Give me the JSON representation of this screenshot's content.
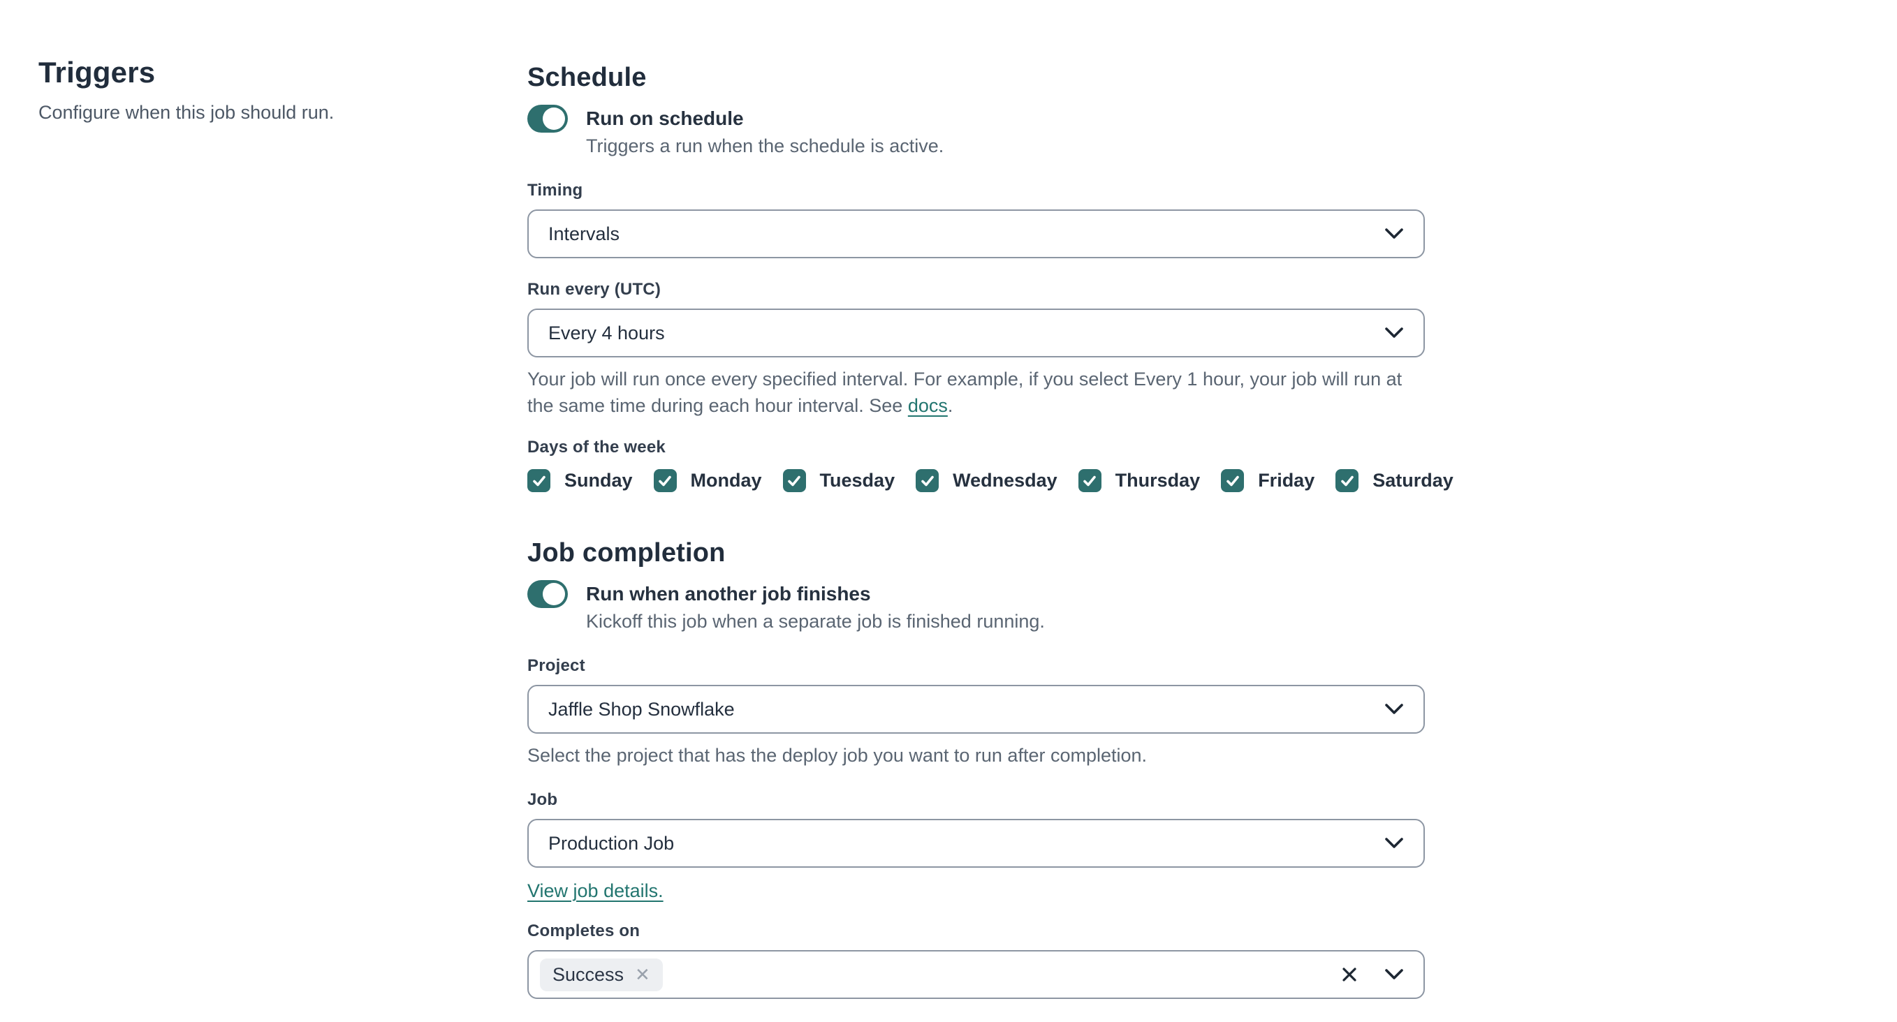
{
  "left_panel": {
    "title": "Triggers",
    "subtitle": "Configure when this job should run."
  },
  "schedule": {
    "heading": "Schedule",
    "run_on_schedule": {
      "label": "Run on schedule",
      "description": "Triggers a run when the schedule is active.",
      "state": "on"
    },
    "timing": {
      "label": "Timing",
      "value": "Intervals"
    },
    "run_every": {
      "label": "Run every (UTC)",
      "value": "Every 4 hours"
    },
    "interval_help": {
      "text_before_link": "Your job will run once every specified interval. For example, if you select Every 1 hour, your job will run at the same time during each hour interval. See ",
      "link_text": "docs",
      "text_after_link": "."
    },
    "days_of_week": {
      "label": "Days of the week",
      "items": [
        {
          "label": "Sunday",
          "checked": true
        },
        {
          "label": "Monday",
          "checked": true
        },
        {
          "label": "Tuesday",
          "checked": true
        },
        {
          "label": "Wednesday",
          "checked": true
        },
        {
          "label": "Thursday",
          "checked": true
        },
        {
          "label": "Friday",
          "checked": true
        },
        {
          "label": "Saturday",
          "checked": true
        }
      ]
    }
  },
  "job_completion": {
    "heading": "Job completion",
    "run_when_finishes": {
      "label": "Run when another job finishes",
      "description": "Kickoff this job when a separate job is finished running.",
      "state": "on"
    },
    "project": {
      "label": "Project",
      "value": "Jaffle Shop Snowflake",
      "help": "Select the project that has the deploy job you want to run after completion."
    },
    "job": {
      "label": "Job",
      "value": "Production Job",
      "link_text": "View job details."
    },
    "completes_on": {
      "label": "Completes on",
      "selected_tags": [
        "Success"
      ]
    }
  },
  "colors": {
    "accent_teal": "#2e6f6e",
    "link_teal": "#22756f",
    "heading_dark": "#212d3c",
    "border_gray": "#8d96a3"
  }
}
